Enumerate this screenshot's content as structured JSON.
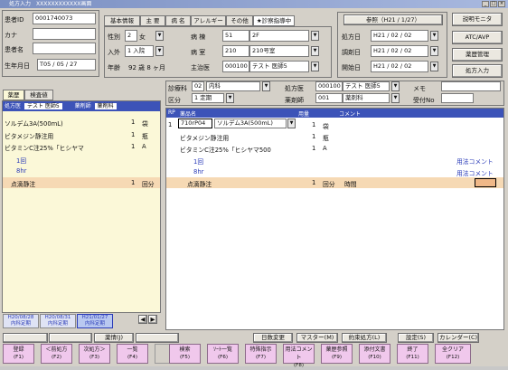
{
  "window": {
    "title": "処方入力　XXXXXXXXXXXX画面"
  },
  "patient": {
    "id_label": "患者ID",
    "id_value": "0001740073",
    "kana_label": "カナ",
    "kana_value": "",
    "name_label": "患者名",
    "name_value": "",
    "dob_label": "生年月日",
    "dob_value": "T05 / 05 / 27"
  },
  "tabs": [
    "基本情報",
    "主 要",
    "病 名",
    "アレルギー",
    "その他",
    "★診察指導中"
  ],
  "basic": {
    "sex_label": "性別",
    "sex_value": "2",
    "sex_text": "女",
    "nyuin_label": "入外",
    "nyuin_value": "1",
    "nyuin_text": "入院",
    "age_label": "年齢",
    "age_value": "92 歳 8 ヶ月",
    "byoto_label": "病 棟",
    "byoto_value": "51",
    "byoto_text": "2F",
    "byoshitsu_label": "病 室",
    "byoshitsu_value": "210",
    "byoshitsu_text": "210号室",
    "shujii_label": "主治医",
    "shujii_value": "000100",
    "shujii_text": "テスト 医師5"
  },
  "visit": {
    "button": "参照（H21 / 1/27）",
    "shohobi_label": "処方日",
    "shohobi_value": "H21 / 02 / 02",
    "chozaibi_label": "調剤日",
    "chozaibi_value": "H21 / 02 / 02",
    "kaishibi_label": "開始日",
    "kaishibi_value": "H21 / 02 / 02"
  },
  "side_buttons": [
    "説明モニタ",
    "ATC/AVP",
    "薬歴管理",
    "処方入力"
  ],
  "left_panel": {
    "tabs": [
      "薬歴",
      "検査値"
    ],
    "doctor_label": "処方医",
    "doctor_value": "テスト 医師5",
    "dept_label": "薬剤師",
    "dept_value": "薬剤科",
    "items": [
      {
        "name": "ソルデム3A(500mL)",
        "qty": "1",
        "unit": "袋"
      },
      {
        "name": "ビタメジン静注用",
        "qty": "1",
        "unit": "瓶"
      },
      {
        "name": "ビタミンC注25%「ヒシヤマ",
        "qty": "1",
        "unit": "A"
      },
      {
        "name": "1回",
        "qty": "",
        "unit": ""
      },
      {
        "name": "8hr",
        "qty": "",
        "unit": ""
      },
      {
        "name": "点滴静注",
        "qty": "1",
        "unit": "回分"
      }
    ],
    "history": [
      {
        "date": "H20/08/28",
        "label": "内科定期"
      },
      {
        "date": "H20/08/31",
        "label": "内科定期"
      },
      {
        "date": "H21/01/27",
        "label": "内科定期"
      }
    ]
  },
  "order": {
    "shinryoka_label": "診療科",
    "shinryoka_value": "02",
    "shinryoka_text": "内科",
    "kubun_label": "区分",
    "kubun_value": "1",
    "kubun_text": "定期",
    "shohoi_label": "処方医",
    "shohoi_value": "000100",
    "shohoi_text": "テスト 医師5",
    "yakuzaishi_label": "薬剤師",
    "yakuzaishi_value": "001",
    "yakuzaishi_text": "薬剤科",
    "memo_label": "メモ",
    "memo_value": "",
    "uketsuke_label": "受付No",
    "uketsuke_value": ""
  },
  "grid": {
    "headers": [
      "RP",
      "薬品名",
      "用量",
      "コメント"
    ],
    "rp": "1",
    "code": "710rP04",
    "rows": [
      {
        "name": "ソルデム3A(500mL)",
        "qty": "1",
        "unit": "袋",
        "comment": ""
      },
      {
        "name": "ビタメジン静注用",
        "qty": "1",
        "unit": "瓶",
        "comment": ""
      },
      {
        "name": "ビタミンC注25%「ヒシヤマ500",
        "qty": "1",
        "unit": "A",
        "comment": ""
      },
      {
        "name": "1回",
        "qty": "",
        "unit": "",
        "comment": "用法コメント"
      },
      {
        "name": "8hr",
        "qty": "",
        "unit": "",
        "comment": "用法コメント"
      },
      {
        "name": "点滴静注",
        "qty": "1",
        "unit": "回分",
        "comment": "時間"
      }
    ]
  },
  "toolbar": [
    "薬情(J)",
    "",
    "",
    "",
    "日数変更",
    "マスター(M)",
    "約束処方(L)",
    "設定(S)",
    "カレンダー(C)"
  ],
  "fkeys": [
    {
      "label": "登録",
      "key": "(F1)"
    },
    {
      "label": "＜前処方",
      "key": "(F2)"
    },
    {
      "label": "次処方＞",
      "key": "(F3)"
    },
    {
      "label": "一覧",
      "key": "(F4)"
    },
    {
      "label": "",
      "key": ""
    },
    {
      "label": "検索",
      "key": "(F5)"
    },
    {
      "label": "ｿｰﾄ一覧",
      "key": "(F6)"
    },
    {
      "label": "特殊指示",
      "key": "(F7)"
    },
    {
      "label": "用法コメント",
      "key": "(F8)"
    },
    {
      "label": "薬歴参照",
      "key": "(F9)"
    },
    {
      "label": "添付文書",
      "key": "(F10)"
    },
    {
      "label": "終了",
      "key": "(F11)"
    },
    {
      "label": "全クリア",
      "key": "(F12)"
    }
  ],
  "colors": {
    "selected_row": "#f6d9b4",
    "left_bg": "#fbf8d8",
    "fkey": "#f0c8ec",
    "header": "#3c53b8"
  }
}
